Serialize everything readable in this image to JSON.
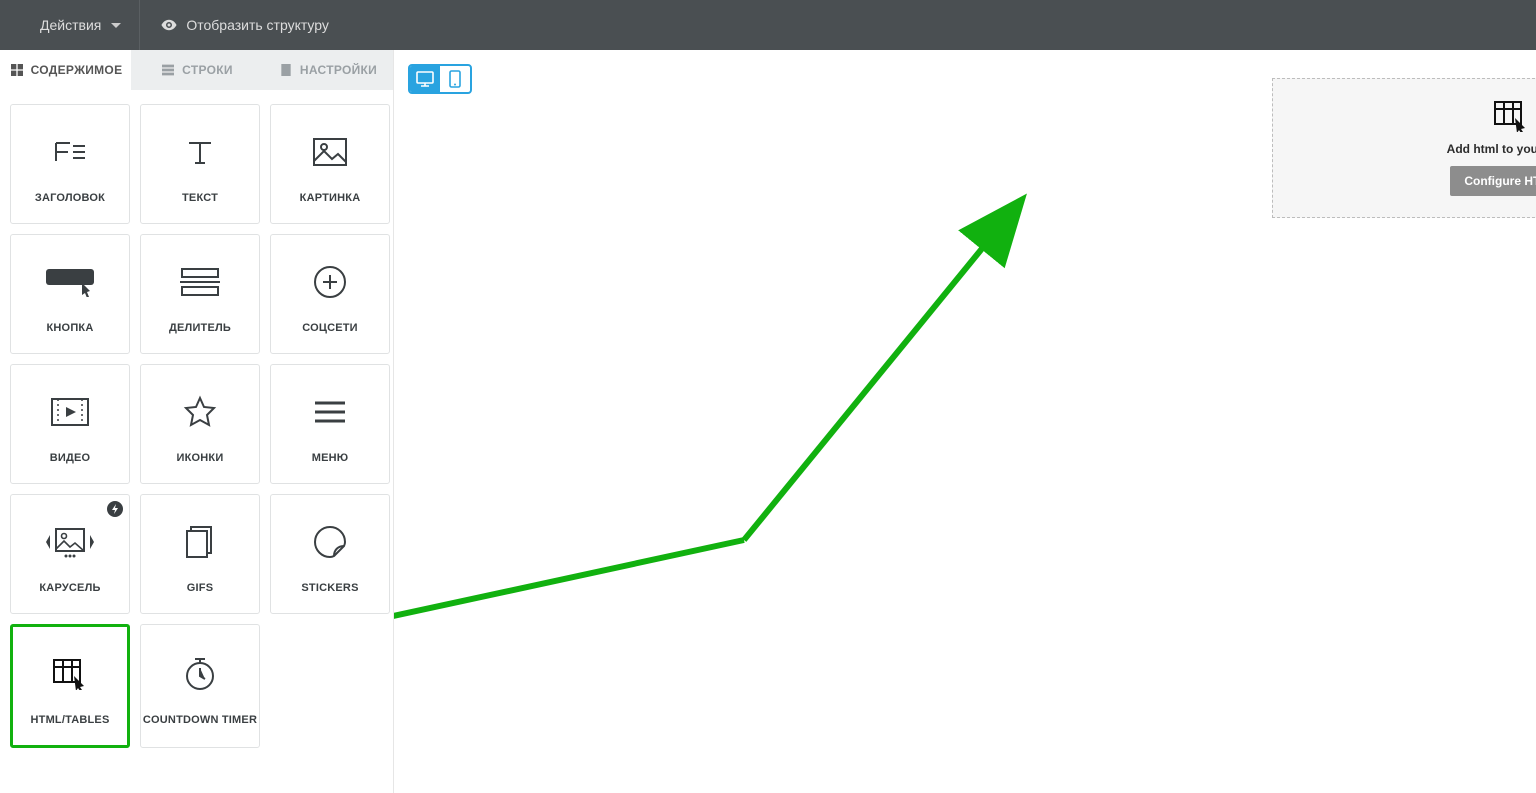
{
  "topbar": {
    "actions_label": "Действия",
    "show_structure_label": "Отобразить структуру"
  },
  "tabs": {
    "content": "СОДЕРЖИМОЕ",
    "rows": "СТРОКИ",
    "settings": "НАСТРОЙКИ"
  },
  "blocks": [
    {
      "id": "heading",
      "label": "ЗАГОЛОВОК"
    },
    {
      "id": "text",
      "label": "ТЕКСТ"
    },
    {
      "id": "image",
      "label": "КАРТИНКА"
    },
    {
      "id": "button",
      "label": "КНОПКА"
    },
    {
      "id": "divider",
      "label": "ДЕЛИТЕЛЬ"
    },
    {
      "id": "social",
      "label": "СОЦСЕТИ"
    },
    {
      "id": "video",
      "label": "ВИДЕО"
    },
    {
      "id": "icons",
      "label": "ИКОНКИ"
    },
    {
      "id": "menu",
      "label": "МЕНЮ"
    },
    {
      "id": "carousel",
      "label": "КАРУСЕЛЬ",
      "badge": true
    },
    {
      "id": "gifs",
      "label": "GIFS"
    },
    {
      "id": "stickers",
      "label": "STICKERS"
    },
    {
      "id": "html",
      "label": "HTML/TABLES",
      "highlight": true
    },
    {
      "id": "countdown",
      "label": "COUNTDOWN TIMER"
    }
  ],
  "canvas": {
    "html_block": {
      "hint": "Add html to your letter",
      "button": "Configure HTML"
    }
  },
  "icons": {
    "badge_bolt": "⚡"
  }
}
